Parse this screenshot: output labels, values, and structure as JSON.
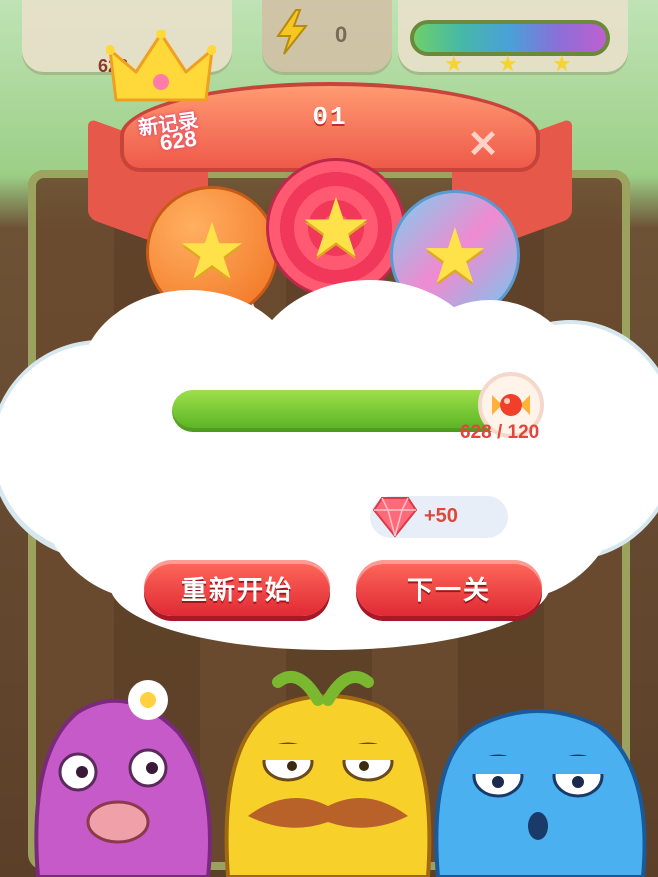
{
  "hud": {
    "score_peek": "628",
    "moves": "0",
    "stars_earned": 3
  },
  "result": {
    "level_number": "01",
    "new_record_label": "新记录",
    "new_record_value": "628",
    "stars": 3,
    "progress_fraction": 1.0,
    "score_ratio": "628 / 120",
    "reward_text": "+50"
  },
  "buttons": {
    "restart_label": "重新开始",
    "next_label": "下一关"
  },
  "colors": {
    "button_red": "#e02a34",
    "progress_green": "#56b023",
    "ribbon": "#ef5a4a",
    "star_yellow": "#ffe14a"
  },
  "icons": [
    "bolt-icon",
    "crown-icon",
    "close-icon",
    "candy-icon",
    "gem-icon",
    "star-icon"
  ]
}
